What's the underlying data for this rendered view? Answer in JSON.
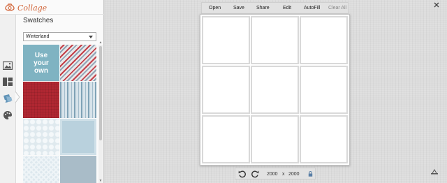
{
  "app": {
    "name": "Collage"
  },
  "sidebar": {
    "title": "Swatches",
    "dropdown": {
      "selected": "Winterland"
    },
    "swatches": [
      {
        "label": "Use your own"
      }
    ],
    "tools": [
      "photos-icon",
      "layouts-icon",
      "swatches-icon",
      "stickers-icon"
    ]
  },
  "toolbar": {
    "open": "Open",
    "save": "Save",
    "share": "Share",
    "edit": "Edit",
    "autofill": "AutoFill",
    "clear_all": "Clear All"
  },
  "canvas_size": {
    "width": "2000",
    "x": "x",
    "height": "2000"
  },
  "colors": {
    "accent": "#d2663a",
    "swatch_tile": "#7fb3c2",
    "lock": "#5a7fa6"
  }
}
